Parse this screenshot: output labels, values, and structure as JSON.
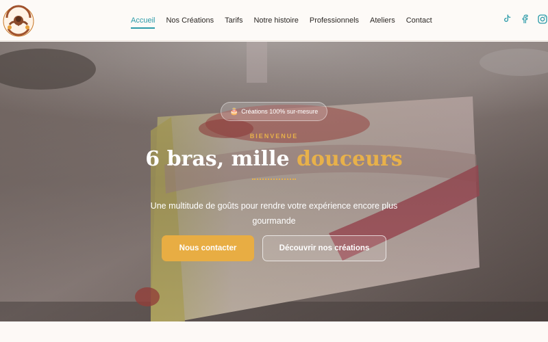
{
  "header": {
    "logo_alt": "Les Délices de Sassoua",
    "nav": [
      {
        "label": "Accueil",
        "active": true
      },
      {
        "label": "Nos Créations",
        "active": false
      },
      {
        "label": "Tarifs",
        "active": false
      },
      {
        "label": "Notre histoire",
        "active": false
      },
      {
        "label": "Professionnels",
        "active": false
      },
      {
        "label": "Ateliers",
        "active": false
      },
      {
        "label": "Contact",
        "active": false
      }
    ],
    "social": [
      "tiktok-icon",
      "facebook-icon",
      "instagram-icon"
    ]
  },
  "hero": {
    "badge": "Créations 100% sur-mesure",
    "badge_icon": "🎂",
    "eyebrow": "BIENVENUE",
    "headline_main": "6 bras, mille ",
    "headline_accent": "douceurs",
    "subtitle": "Une multitude de goûts pour rendre votre expérience encore plus gourmande",
    "primary_button": "Nous contacter",
    "secondary_button": "Découvrir nos créations"
  },
  "colors": {
    "accent_teal": "#2a9aa8",
    "accent_gold": "#e8b14a",
    "button_gold": "#e8ad43"
  }
}
